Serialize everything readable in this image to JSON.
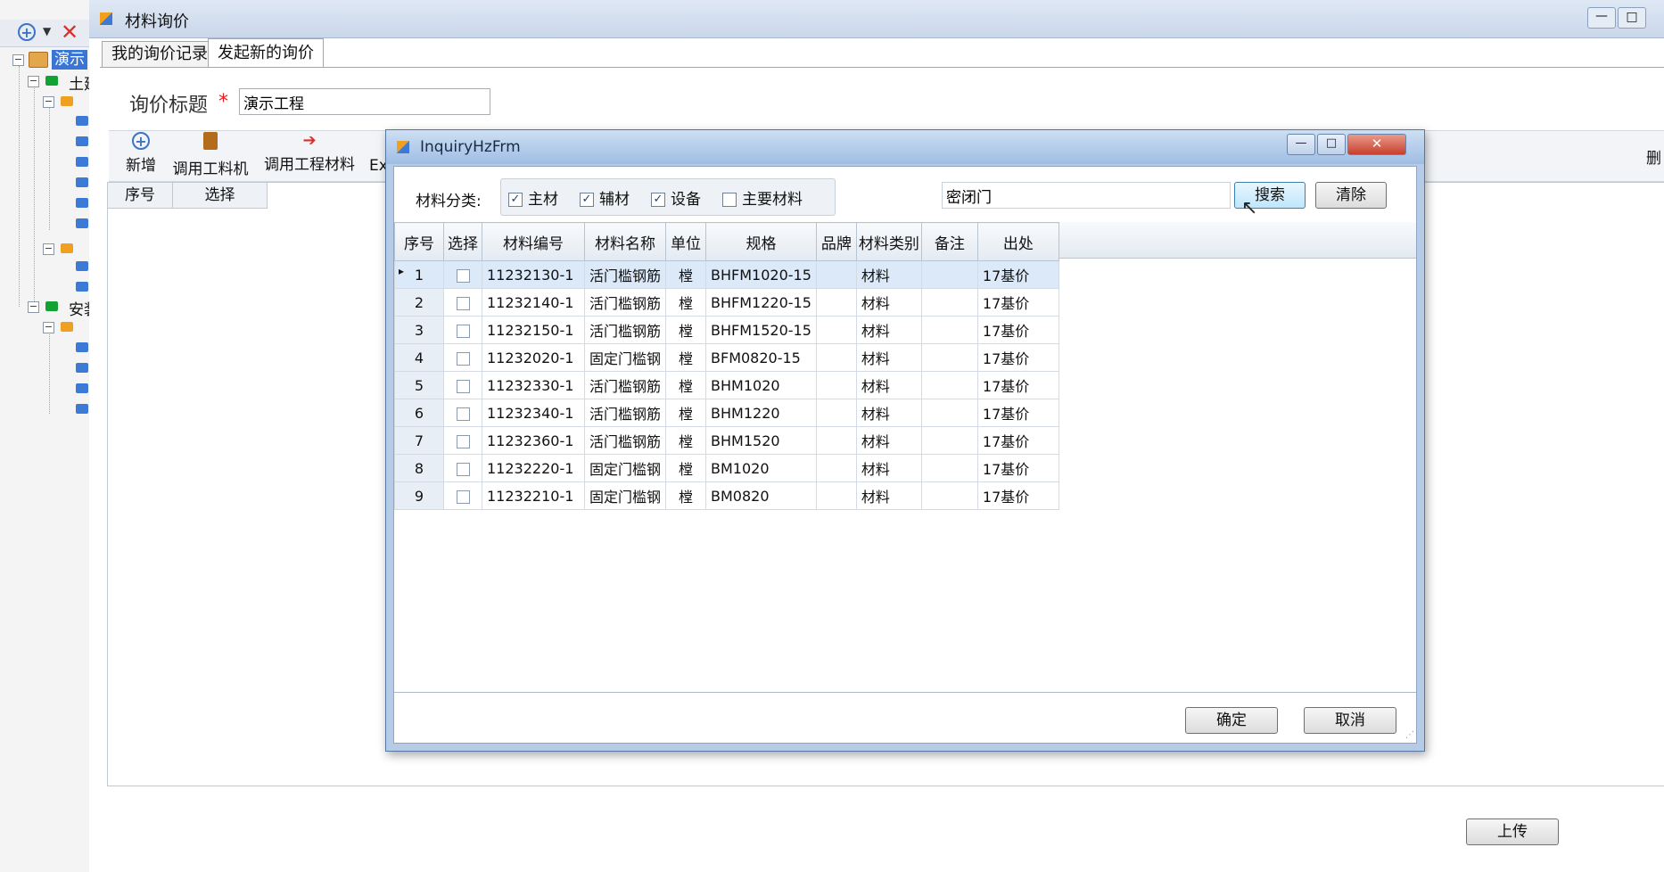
{
  "tree": {
    "root_label": "演示",
    "node1_label": "土建",
    "node2_label": "安装"
  },
  "main": {
    "title": "材料询价",
    "tabs": [
      {
        "label": "我的询价记录"
      },
      {
        "label": "发起新的询价"
      }
    ],
    "inquiry_title_label": "询价标题",
    "required_mark": "*",
    "inquiry_title_value": "演示工程",
    "toolbar": {
      "add_label": "新增",
      "use_labor_material_label": "调用工料机",
      "use_project_material_label": "调用工程材料",
      "export_label": "Ex",
      "delete_label": "删"
    },
    "grid_headers": [
      "序号",
      "选择"
    ],
    "upload_label": "上传"
  },
  "dialog": {
    "title": "InquiryHzFrm",
    "filter_label": "材料分类:",
    "filters": [
      {
        "label": "主材",
        "checked": true
      },
      {
        "label": "辅材",
        "checked": true
      },
      {
        "label": "设备",
        "checked": true
      },
      {
        "label": "主要材料",
        "checked": false
      }
    ],
    "search_value": "密闭门",
    "search_label": "搜索",
    "clear_label": "清除",
    "columns": [
      "序号",
      "选择",
      "材料编号",
      "材料名称",
      "单位",
      "规格",
      "品牌",
      "材料类别",
      "备注",
      "出处"
    ],
    "rows": [
      {
        "no": "1",
        "code": "11232130-1",
        "name": "活门槛钢筋",
        "unit": "樘",
        "spec": "BHFM1020-15",
        "brand": "",
        "category": "材料",
        "note": "",
        "source": "17基价"
      },
      {
        "no": "2",
        "code": "11232140-1",
        "name": "活门槛钢筋",
        "unit": "樘",
        "spec": "BHFM1220-15",
        "brand": "",
        "category": "材料",
        "note": "",
        "source": "17基价"
      },
      {
        "no": "3",
        "code": "11232150-1",
        "name": "活门槛钢筋",
        "unit": "樘",
        "spec": "BHFM1520-15",
        "brand": "",
        "category": "材料",
        "note": "",
        "source": "17基价"
      },
      {
        "no": "4",
        "code": "11232020-1",
        "name": "固定门槛钢",
        "unit": "樘",
        "spec": "BFM0820-15",
        "brand": "",
        "category": "材料",
        "note": "",
        "source": "17基价"
      },
      {
        "no": "5",
        "code": "11232330-1",
        "name": "活门槛钢筋",
        "unit": "樘",
        "spec": "BHM1020",
        "brand": "",
        "category": "材料",
        "note": "",
        "source": "17基价"
      },
      {
        "no": "6",
        "code": "11232340-1",
        "name": "活门槛钢筋",
        "unit": "樘",
        "spec": "BHM1220",
        "brand": "",
        "category": "材料",
        "note": "",
        "source": "17基价"
      },
      {
        "no": "7",
        "code": "11232360-1",
        "name": "活门槛钢筋",
        "unit": "樘",
        "spec": "BHM1520",
        "brand": "",
        "category": "材料",
        "note": "",
        "source": "17基价"
      },
      {
        "no": "8",
        "code": "11232220-1",
        "name": "固定门槛钢",
        "unit": "樘",
        "spec": "BM1020",
        "brand": "",
        "category": "材料",
        "note": "",
        "source": "17基价"
      },
      {
        "no": "9",
        "code": "11232210-1",
        "name": "固定门槛钢",
        "unit": "樘",
        "spec": "BM0820",
        "brand": "",
        "category": "材料",
        "note": "",
        "source": "17基价"
      }
    ],
    "ok_label": "确定",
    "cancel_label": "取消"
  }
}
